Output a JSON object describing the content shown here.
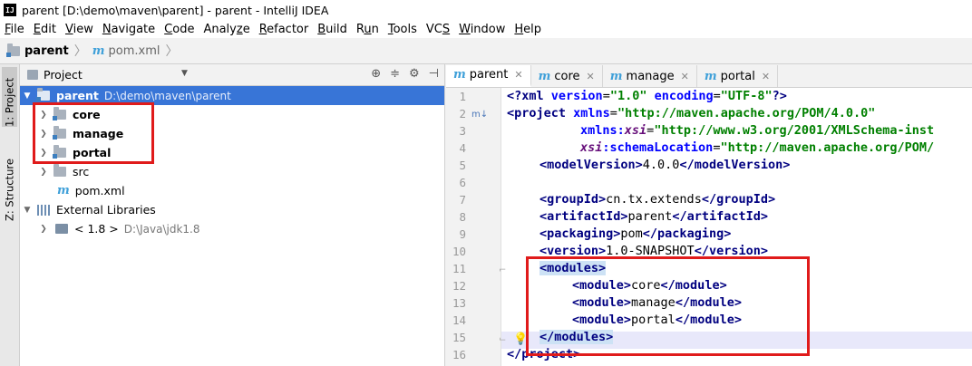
{
  "window": {
    "title": "parent [D:\\demo\\maven\\parent] - parent - IntelliJ IDEA",
    "app_icon": "IJ"
  },
  "menu": [
    "File",
    "Edit",
    "View",
    "Navigate",
    "Code",
    "Analyze",
    "Refactor",
    "Build",
    "Run",
    "Tools",
    "VCS",
    "Window",
    "Help"
  ],
  "menu_mnemonic": [
    "F",
    "E",
    "V",
    "N",
    "C",
    "z",
    "R",
    "B",
    "u",
    "T",
    "S",
    "W",
    "H"
  ],
  "breadcrumb": {
    "project": "parent",
    "file": "pom.xml"
  },
  "side_tabs": {
    "project": "1: Project",
    "structure": "Z: Structure"
  },
  "project_panel": {
    "title": "Project",
    "tree": [
      {
        "label": "parent",
        "path": "D:\\demo\\maven\\parent",
        "selected": true
      },
      {
        "label": "core"
      },
      {
        "label": "manage"
      },
      {
        "label": "portal"
      },
      {
        "label": "src"
      },
      {
        "label": "pom.xml"
      },
      {
        "label": "External Libraries"
      },
      {
        "label": "< 1.8 >",
        "path": "D:\\Java\\jdk1.8"
      }
    ]
  },
  "editor": {
    "tabs": [
      {
        "label": "parent",
        "active": true
      },
      {
        "label": "core"
      },
      {
        "label": "manage"
      },
      {
        "label": "portal"
      }
    ],
    "line_numbers": [
      "1",
      "2",
      "3",
      "4",
      "5",
      "6",
      "7",
      "8",
      "9",
      "10",
      "11",
      "12",
      "13",
      "14",
      "15",
      "16"
    ],
    "code": {
      "xml_decl": {
        "open": "<?xml ",
        "a1": "version",
        "v1": "\"1.0\"",
        "a2": " encoding",
        "v2": "\"UTF-8\"",
        "close": "?>"
      },
      "project_open": {
        "tag": "<project ",
        "a1": "xmlns",
        "v1": "\"http://maven.apache.org/POM/4.0.0\""
      },
      "xsi": {
        "a": "xmlns:",
        "ns": "xsi",
        "v": "\"http://www.w3.org/2001/XMLSchema-inst"
      },
      "schema": {
        "ns": "xsi",
        "a": ":schemaLocation",
        "v": "\"http://maven.apache.org/POM/"
      },
      "model_version": {
        "open": "<modelVersion>",
        "text": "4.0.0",
        "close": "</modelVersion>"
      },
      "group_id": {
        "open": "<groupId>",
        "text": "cn.tx.extends",
        "close": "</groupId>"
      },
      "artifact_id": {
        "open": "<artifactId>",
        "text": "parent",
        "close": "</artifactId>"
      },
      "packaging": {
        "open": "<packaging>",
        "text": "pom",
        "close": "</packaging>"
      },
      "version": {
        "open": "<version>",
        "text": "1.0-SNAPSHOT",
        "close": "</version>"
      },
      "modules_open": "<modules>",
      "module_core": {
        "open": "<module>",
        "text": "core",
        "close": "</module>"
      },
      "module_manage": {
        "open": "<module>",
        "text": "manage",
        "close": "</module>"
      },
      "module_portal": {
        "open": "<module>",
        "text": "portal",
        "close": "</module>"
      },
      "modules_close": "</modules>",
      "project_close": "</project>"
    }
  }
}
